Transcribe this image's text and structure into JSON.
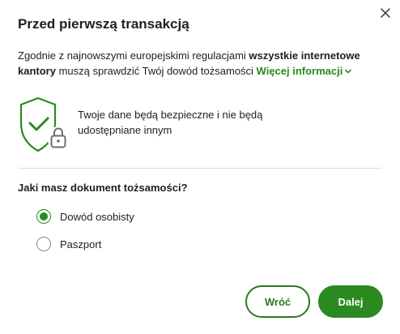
{
  "dialog": {
    "title": "Przed pierwszą transakcją",
    "intro": {
      "text_before": "Zgodnie z najnowszymi europejskimi regulacjami ",
      "bold_text": "wszystkie internetowe kantory",
      "text_after": " muszą sprawdzić Twój dowód tożsamości ",
      "link_label": "Więcej informacji"
    },
    "safety_message": "Twoje dane będą bezpieczne i nie będą udostępniane innym",
    "question": "Jaki masz dokument tożsamości?",
    "options": [
      {
        "label": "Dowód osobisty",
        "selected": true
      },
      {
        "label": "Paszport",
        "selected": false
      }
    ],
    "buttons": {
      "back_label": "Wróć",
      "next_label": "Dalej"
    }
  },
  "icons": {
    "close": "close-icon",
    "chevron": "chevron-down-icon",
    "shield": "shield-check-lock-icon"
  },
  "colors": {
    "accent": "#2a8a1f",
    "text": "#1f1f1f",
    "divider": "#dddddd"
  }
}
